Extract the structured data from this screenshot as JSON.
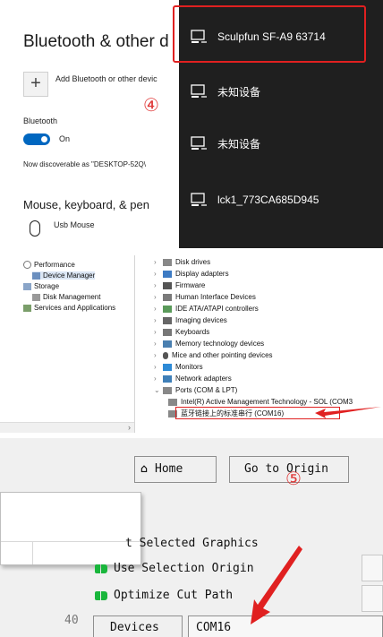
{
  "bluetooth": {
    "title": "Bluetooth & other d",
    "add_device": "Add Bluetooth or other devic",
    "section_label": "Bluetooth",
    "toggle_state": "On",
    "discoverable": "Now discoverable as \"DESKTOP-52Q\\",
    "mouse_section": "Mouse, keyboard, & pen",
    "mouse_device": "Usb Mouse",
    "step_marker": "④"
  },
  "flyout": {
    "devices": [
      {
        "label": "Sculpfun SF-A9 63714",
        "icon": "device-display-icon",
        "highlighted": true
      },
      {
        "label": "未知设备",
        "icon": "device-display-icon"
      },
      {
        "label": "未知设备",
        "icon": "device-display-icon"
      },
      {
        "label": "lck1_773CA685D945",
        "icon": "device-display-icon"
      }
    ],
    "highlight_color": "#e02020",
    "background": "#1f1f1f"
  },
  "device_manager": {
    "left_tree": [
      {
        "label": "Performance",
        "icon": "performance-icon"
      },
      {
        "label": "Device Manager",
        "icon": "device-manager-icon",
        "selected": true
      },
      {
        "label": "Storage",
        "icon": "storage-icon"
      },
      {
        "label": "Disk Management",
        "icon": "disk-management-icon"
      },
      {
        "label": "Services and Applications",
        "icon": "services-icon"
      }
    ],
    "right_tree": [
      {
        "label": "Disk drives",
        "icon": "disk-icon"
      },
      {
        "label": "Display adapters",
        "icon": "display-adapter-icon"
      },
      {
        "label": "Firmware",
        "icon": "firmware-icon"
      },
      {
        "label": "Human Interface Devices",
        "icon": "hid-icon"
      },
      {
        "label": "IDE ATA/ATAPI controllers",
        "icon": "ide-icon"
      },
      {
        "label": "Imaging devices",
        "icon": "camera-icon"
      },
      {
        "label": "Keyboards",
        "icon": "keyboard-icon"
      },
      {
        "label": "Memory technology devices",
        "icon": "memory-icon"
      },
      {
        "label": "Mice and other pointing devices",
        "icon": "mouse-icon"
      },
      {
        "label": "Monitors",
        "icon": "monitor-icon"
      },
      {
        "label": "Network adapters",
        "icon": "network-icon"
      },
      {
        "label": "Ports (COM & LPT)",
        "icon": "port-icon"
      }
    ],
    "ports_children": [
      {
        "label": "Intel(R) Active Management Technology - SOL (COM3",
        "icon": "port-icon"
      },
      {
        "label": "蓝牙链接上的标准串行 (COM16)",
        "icon": "port-icon",
        "highlighted": true
      }
    ]
  },
  "lightburn": {
    "home_button": "Home",
    "go_to_origin": "Go to Origin",
    "step_marker": "⑤",
    "options": [
      {
        "label": "t Selected Graphics",
        "checked": false
      },
      {
        "label": "Use Selection Origin",
        "checked": true
      },
      {
        "label": "Optimize Cut Path",
        "checked": true
      }
    ],
    "row_number": "40",
    "devices_button": "Devices",
    "port_value": "COM16"
  }
}
